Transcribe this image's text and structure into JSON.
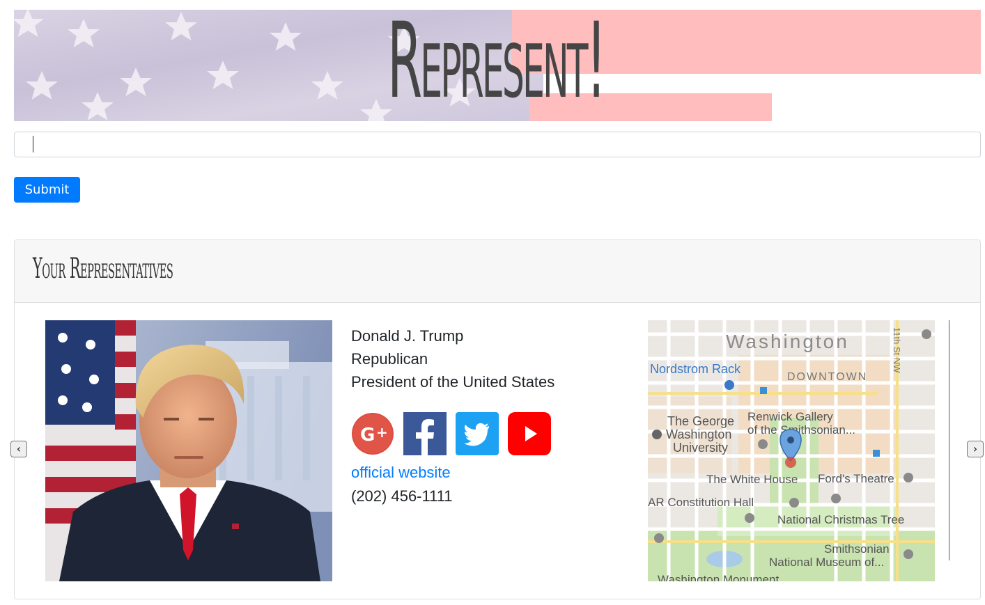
{
  "banner": {
    "title": "Represent!"
  },
  "search": {
    "value": "",
    "submit_label": "Submit"
  },
  "panel": {
    "title": "Your Representatives",
    "prev_arrow": "‹",
    "next_arrow": "›"
  },
  "representative": {
    "name": "Donald J. Trump",
    "party": "Republican",
    "office": "President of the United States",
    "website_label": "official website",
    "phone": "(202) 456-1111",
    "social": [
      {
        "name": "google-plus",
        "glyph": "G+",
        "color": "#dc4e41"
      },
      {
        "name": "facebook",
        "glyph": "f",
        "color": "#3b5998"
      },
      {
        "name": "twitter",
        "glyph": "twitter-bird",
        "color": "#1da1f2"
      },
      {
        "name": "youtube",
        "glyph": "play",
        "color": "#ff0000"
      }
    ]
  },
  "map": {
    "city": "Washington",
    "district": "DOWNTOWN",
    "street": "11th St NW",
    "places": {
      "nordstrom": "Nordstrom Rack",
      "gwu_1": "The George",
      "gwu_2": "Washington",
      "gwu_3": "University",
      "renwick_1": "Renwick Gallery",
      "renwick_2": "of the Smithsonian...",
      "white_house": "The White House",
      "fords": "Ford's Theatre",
      "dar": "AR Constitution Hall",
      "tree": "National Christmas Tree",
      "smith_1": "Smithsonian",
      "smith_2": "National Museum of...",
      "monument": "Washington Monument"
    }
  }
}
